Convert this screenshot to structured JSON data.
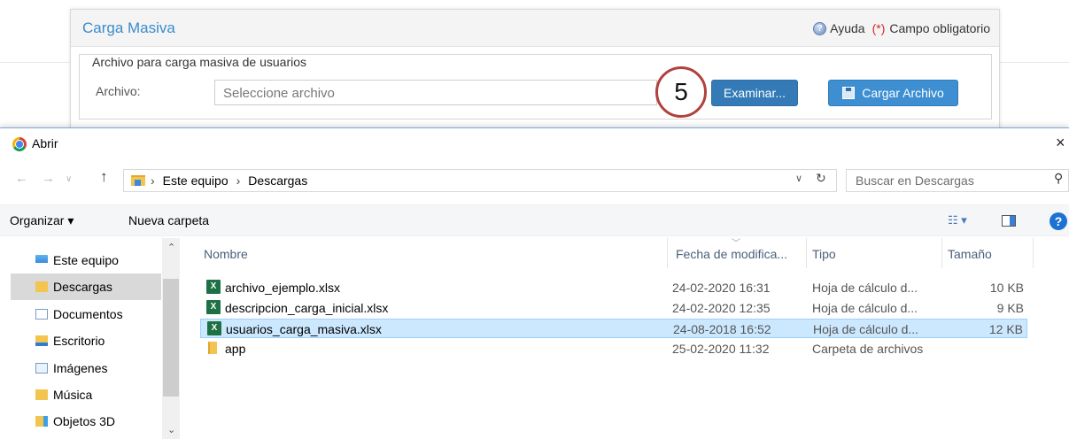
{
  "web": {
    "panel_title": "Carga Masiva",
    "help_label": "Ayuda",
    "required_mark": "(*)",
    "required_label": "Campo obligatorio",
    "fieldset_legend": "Archivo para carga masiva de usuarios",
    "archivo_label": "Archivo:",
    "archivo_placeholder": "Seleccione archivo",
    "examinar_button": "Examinar...",
    "cargar_button": "Cargar Archivo",
    "step_number": "5",
    "colors": {
      "title": "#3a8ccd",
      "button": "#337ab7",
      "step_ring": "#b0413e"
    }
  },
  "dialog": {
    "title": "Abrir",
    "close": "×",
    "nav": {
      "back": "←",
      "forward": "→",
      "recent": "∨",
      "up": "↑"
    },
    "breadcrumb": [
      "Este equipo",
      "Descargas"
    ],
    "search_placeholder": "Buscar en Descargas",
    "toolbar": {
      "organize": "Organizar ▾",
      "new_folder": "Nueva carpeta",
      "help": "?"
    },
    "nav_pane": [
      {
        "label": "Este equipo",
        "icon": "computer-icon"
      },
      {
        "label": "Descargas",
        "icon": "downloads-folder-icon",
        "selected": true
      },
      {
        "label": "Documentos",
        "icon": "documents-icon"
      },
      {
        "label": "Escritorio",
        "icon": "desktop-folder-icon"
      },
      {
        "label": "Imágenes",
        "icon": "pictures-icon"
      },
      {
        "label": "Música",
        "icon": "music-folder-icon"
      },
      {
        "label": "Objetos 3D",
        "icon": "3d-objects-icon"
      }
    ],
    "columns": {
      "name": "Nombre",
      "date": "Fecha de modifica...",
      "type": "Tipo",
      "size": "Tamaño"
    },
    "files": [
      {
        "name": "archivo_ejemplo.xlsx",
        "date": "24-02-2020 16:31",
        "type": "Hoja de cálculo d...",
        "size": "10 KB",
        "icon": "excel-icon"
      },
      {
        "name": "descripcion_carga_inicial.xlsx",
        "date": "24-02-2020 12:35",
        "type": "Hoja de cálculo d...",
        "size": "9 KB",
        "icon": "excel-icon"
      },
      {
        "name": "usuarios_carga_masiva.xlsx",
        "date": "24-08-2018 16:52",
        "type": "Hoja de cálculo d...",
        "size": "12 KB",
        "icon": "excel-icon",
        "selected": true
      },
      {
        "name": "app",
        "date": "25-02-2020 11:32",
        "type": "Carpeta de archivos",
        "size": "",
        "icon": "folder-icon"
      }
    ]
  }
}
